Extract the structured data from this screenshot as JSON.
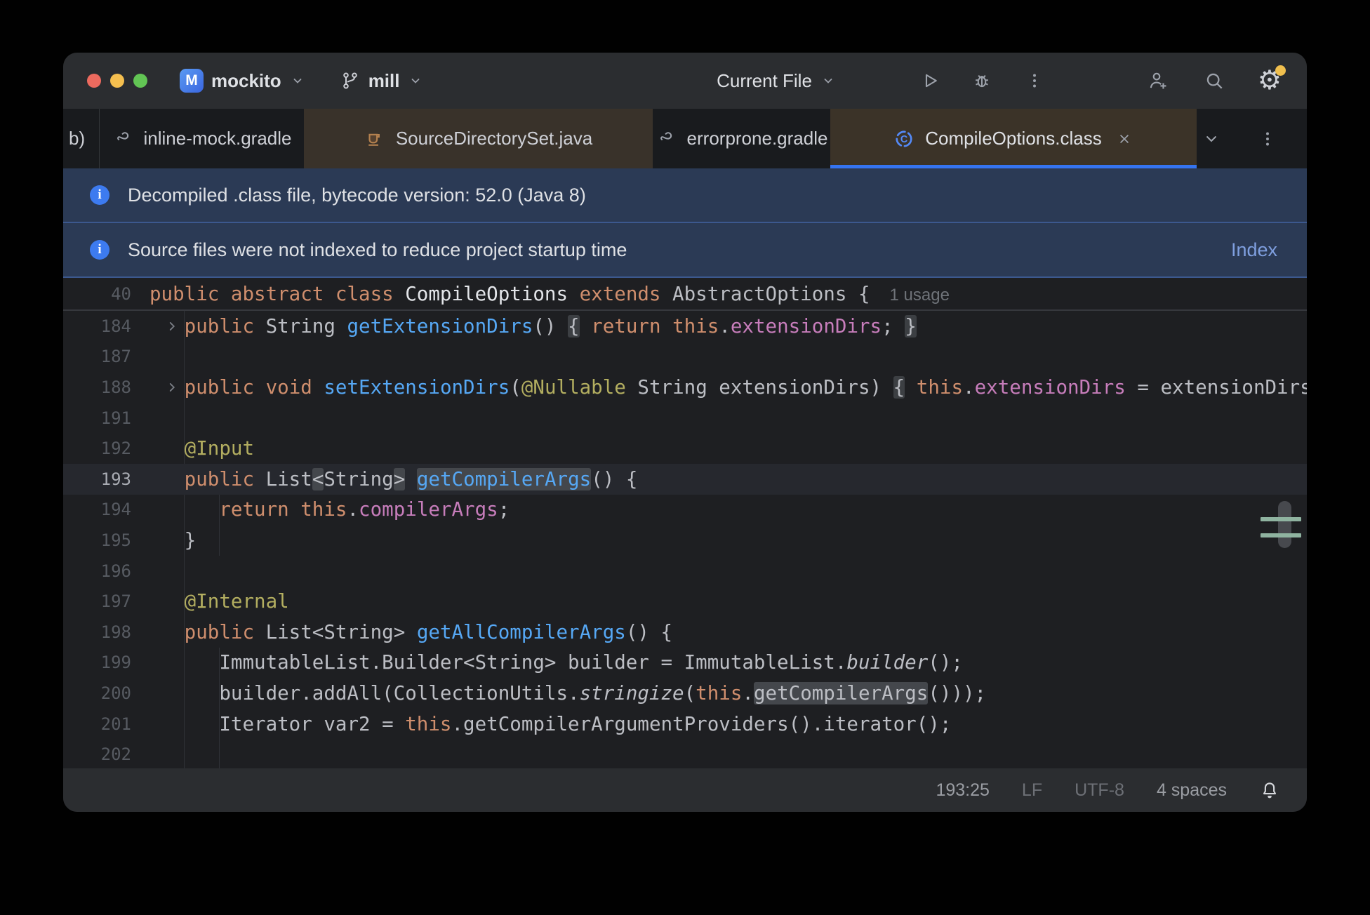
{
  "titlebar": {
    "project_badge": "M",
    "project": "mockito",
    "branch": "mill",
    "run_config": "Current File"
  },
  "tabs": [
    {
      "label": "b)"
    },
    {
      "label": "inline-mock.gradle",
      "icon": "gradle-icon"
    },
    {
      "label": "SourceDirectorySet.java",
      "icon": "java-class-icon"
    },
    {
      "label": "errorprone.gradle",
      "icon": "gradle-icon"
    },
    {
      "label": "CompileOptions.class",
      "icon": "class-icon",
      "active": true,
      "closable": true
    }
  ],
  "banners": [
    {
      "text": "Decompiled .class file, bytecode version: 52.0 (Java 8)"
    },
    {
      "text": "Source files were not indexed to reduce project startup time",
      "action": "Index"
    }
  ],
  "sticky": {
    "line_number": "40",
    "usage_label": "1 usage",
    "segments": [
      [
        "k",
        "public abstract class"
      ],
      [
        "cn",
        " CompileOptions "
      ],
      [
        "k",
        "extends"
      ],
      [
        "d",
        " AbstractOptions {"
      ]
    ]
  },
  "editor": {
    "lines": [
      {
        "n": "184",
        "fold": true,
        "seg": [
          [
            "d",
            "   "
          ],
          [
            "k",
            "public"
          ],
          [
            "d",
            " String "
          ],
          [
            "m",
            "getExtensionDirs"
          ],
          [
            "d",
            "() "
          ],
          [
            "fb",
            "{"
          ],
          [
            "d",
            " "
          ],
          [
            "k",
            "return"
          ],
          [
            "d",
            " "
          ],
          [
            "k",
            "this"
          ],
          [
            "d",
            "."
          ],
          [
            "f",
            "extensionDirs"
          ],
          [
            "d",
            "; "
          ],
          [
            "fb",
            "}"
          ]
        ]
      },
      {
        "n": "187",
        "seg": []
      },
      {
        "n": "188",
        "fold": true,
        "seg": [
          [
            "d",
            "   "
          ],
          [
            "k",
            "public"
          ],
          [
            "d",
            " "
          ],
          [
            "k",
            "void"
          ],
          [
            "d",
            " "
          ],
          [
            "m",
            "setExtensionDirs"
          ],
          [
            "d",
            "("
          ],
          [
            "a",
            "@Nullable"
          ],
          [
            "d",
            " String extensionDirs) "
          ],
          [
            "fb",
            "{"
          ],
          [
            "d",
            " "
          ],
          [
            "k",
            "this"
          ],
          [
            "d",
            "."
          ],
          [
            "f",
            "extensionDirs"
          ],
          [
            "d",
            " = extensionDirs"
          ]
        ]
      },
      {
        "n": "191",
        "seg": []
      },
      {
        "n": "192",
        "seg": [
          [
            "d",
            "   "
          ],
          [
            "a",
            "@Input"
          ]
        ]
      },
      {
        "n": "193",
        "current": true,
        "seg": [
          [
            "d",
            "   "
          ],
          [
            "k",
            "public"
          ],
          [
            "d",
            " List"
          ],
          [
            "hb",
            "<"
          ],
          [
            "d",
            "String"
          ],
          [
            "hb",
            ">"
          ],
          [
            "d",
            " "
          ],
          [
            "mh",
            "getCompilerArgs"
          ],
          [
            "d",
            "() {"
          ]
        ]
      },
      {
        "n": "194",
        "seg": [
          [
            "d",
            "      "
          ],
          [
            "k",
            "return"
          ],
          [
            "d",
            " "
          ],
          [
            "k",
            "this"
          ],
          [
            "d",
            "."
          ],
          [
            "f",
            "compilerArgs"
          ],
          [
            "d",
            ";"
          ]
        ]
      },
      {
        "n": "195",
        "seg": [
          [
            "d",
            "   }"
          ]
        ]
      },
      {
        "n": "196",
        "seg": []
      },
      {
        "n": "197",
        "seg": [
          [
            "d",
            "   "
          ],
          [
            "a",
            "@Internal"
          ]
        ]
      },
      {
        "n": "198",
        "seg": [
          [
            "d",
            "   "
          ],
          [
            "k",
            "public"
          ],
          [
            "d",
            " List<String> "
          ],
          [
            "m",
            "getAllCompilerArgs"
          ],
          [
            "d",
            "() {"
          ]
        ]
      },
      {
        "n": "199",
        "seg": [
          [
            "d",
            "      ImmutableList.Builder<String> builder = ImmutableList."
          ],
          [
            "i",
            "builder"
          ],
          [
            "d",
            "();"
          ]
        ]
      },
      {
        "n": "200",
        "seg": [
          [
            "d",
            "      builder.addAll(CollectionUtils."
          ],
          [
            "i",
            "stringize"
          ],
          [
            "d",
            "("
          ],
          [
            "k",
            "this"
          ],
          [
            "d",
            "."
          ],
          [
            "hb",
            "getCompilerArgs"
          ],
          [
            "d",
            "()));"
          ]
        ]
      },
      {
        "n": "201",
        "seg": [
          [
            "d",
            "      Iterator var2 = "
          ],
          [
            "k",
            "this"
          ],
          [
            "d",
            ".getCompilerArgumentProviders().iterator();"
          ]
        ]
      },
      {
        "n": "202",
        "seg": []
      }
    ]
  },
  "statusbar": {
    "caret": "193:25",
    "line_separator": "LF",
    "encoding": "UTF-8",
    "indent": "4 spaces"
  },
  "colors": {
    "accent": "#3574f0",
    "keyword": "#cf8e6d",
    "method": "#56a8f5",
    "field": "#c77dbb",
    "annotation": "#b3ae60",
    "default_text": "#bcbec4",
    "banner_bg": "#2b3a55",
    "tab_active_bg": "#3b3328",
    "editor_bg": "#1e1f22",
    "chrome_bg": "#2b2d30",
    "scroll_mark_green": "#8fb3a0",
    "settings_badge": "#f0bf4e"
  }
}
